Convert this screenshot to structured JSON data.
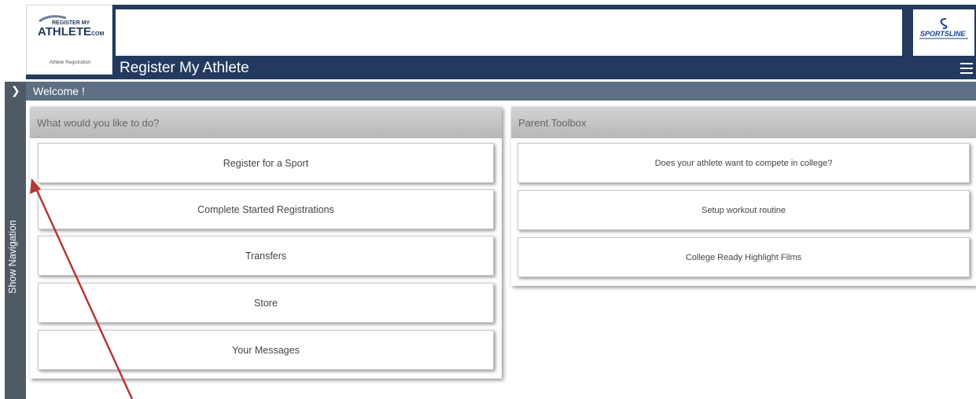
{
  "header": {
    "logo_text": "REGISTER MY ATHLETE.COM",
    "logo_subtitle": "Athlete Registration",
    "title": "Register My Athlete",
    "sponsor_text": "SPORTSLINE"
  },
  "welcome": {
    "text": "Welcome !"
  },
  "nav": {
    "label": "Show Navigation"
  },
  "actions": {
    "heading": "What would you like to do?",
    "items": [
      "Register for a Sport",
      "Complete Started Registrations",
      "Transfers",
      "Store",
      "Your Messages"
    ]
  },
  "toolbox": {
    "heading": "Parent Toolbox",
    "items": [
      "Does your athlete want to compete in college?",
      "Setup workout routine",
      "College Ready Highlight Films"
    ]
  },
  "colors": {
    "header_bg": "#233a5e",
    "welcome_bg": "#5f6f83",
    "nav_bg": "#505a66",
    "arrow": "#b23a34"
  }
}
